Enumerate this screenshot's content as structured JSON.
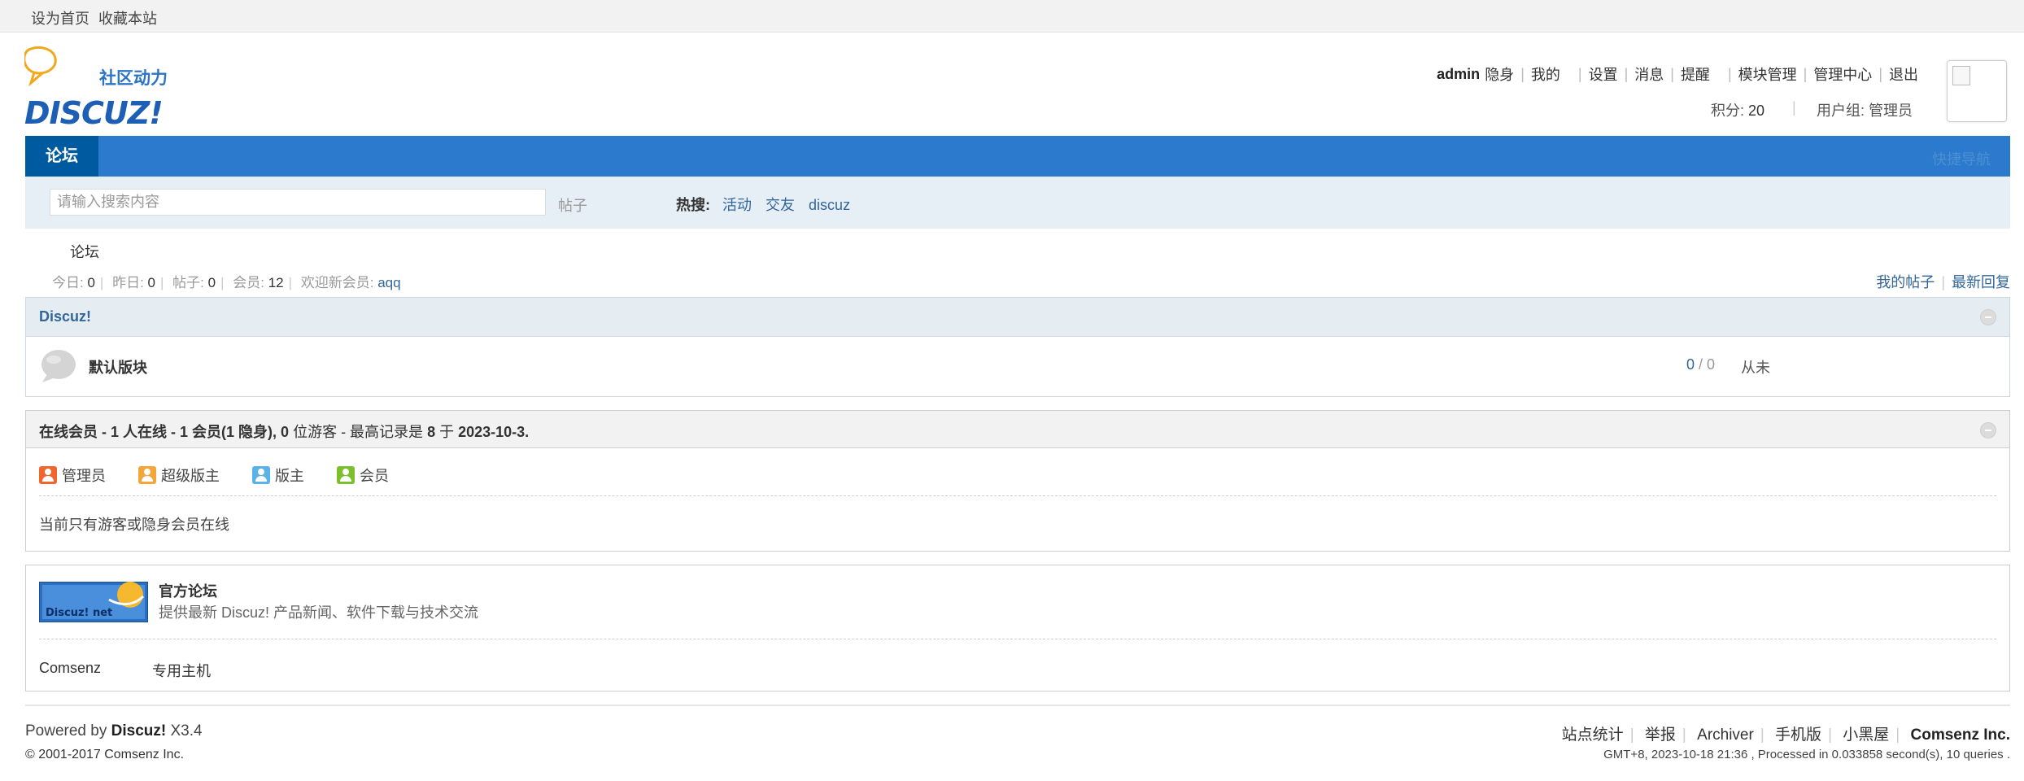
{
  "topbar": {
    "set_home": "设为首页",
    "bookmark": "收藏本站"
  },
  "logo": {
    "brand": "DISCUZ!",
    "slogan": "社区动力"
  },
  "user": {
    "name": "admin",
    "menu": [
      "隐身",
      "我的",
      "设置",
      "消息",
      "提醒",
      "模块管理",
      "管理中心",
      "退出"
    ],
    "credits_label": "积分: ",
    "credits_value": "20",
    "group_label": "用户组: ",
    "group_value": "管理员"
  },
  "nav": {
    "active_tab": "论坛",
    "quick_nav": "快捷导航"
  },
  "search": {
    "placeholder": "请输入搜索内容",
    "type": "帖子",
    "hot_label": "热搜:",
    "hot_words": [
      "活动",
      "交友",
      "discuz"
    ]
  },
  "breadcrumb": "论坛",
  "stats": {
    "today_label": "今日: ",
    "today": "0",
    "yesterday_label": "昨日: ",
    "yesterday": "0",
    "posts_label": "帖子: ",
    "posts": "0",
    "members_label": "会员: ",
    "members": "12",
    "newest_label": "欢迎新会员: ",
    "newest": "aqq"
  },
  "right_links": [
    "我的帖子",
    "最新回复"
  ],
  "category": {
    "title": "Discuz!",
    "forums": [
      {
        "name": "默认版块",
        "threads": "0",
        "posts": "0",
        "last": "从未"
      }
    ]
  },
  "online": {
    "title_prefix": "在线会员 - ",
    "online_count": "1",
    "mid1": " 人在线 - ",
    "member_count": "1",
    "mid2": " 会员(",
    "hidden_count": "1",
    "mid3": " 隐身), ",
    "guest_count": "0",
    "mid4": " 位游客 - 最高记录是 ",
    "record": "8",
    "mid5": " 于 ",
    "record_date": "2023-10-3.",
    "legend": [
      {
        "label": "管理员",
        "color": "#f0662e"
      },
      {
        "label": "超级版主",
        "color": "#f4a63a"
      },
      {
        "label": "版主",
        "color": "#5ab3e6"
      },
      {
        "label": "会员",
        "color": "#7bbf2a"
      }
    ],
    "note": "当前只有游客或隐身会员在线"
  },
  "links": {
    "banner_text": "Discuz! net",
    "title": "官方论坛",
    "desc": "提供最新 Discuz! 产品新闻、软件下载与技术交流",
    "text_links": [
      "Comsenz",
      "专用主机"
    ]
  },
  "footer": {
    "powered_prefix": "Powered by ",
    "powered_brand": "Discuz!",
    "version": " X3.4",
    "copyright": "© 2001-2017 Comsenz Inc.",
    "links": [
      "站点统计",
      "举报",
      "Archiver",
      "手机版",
      "小黑屋"
    ],
    "company": "Comsenz Inc.",
    "info": "GMT+8, 2023-10-18 21:36 , Processed in 0.033858 second(s), 10 queries ."
  },
  "colors": {
    "nav": "#2b7acd",
    "nav_active": "#005aa0",
    "link": "#336699"
  }
}
